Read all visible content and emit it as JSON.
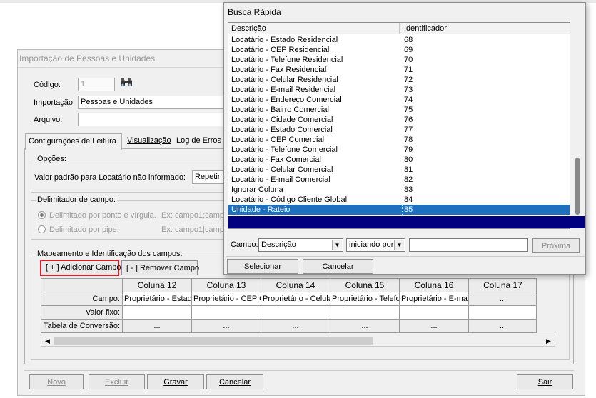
{
  "main_window": {
    "title": "Importação de Pessoas e Unidades",
    "codigo_label": "Código:",
    "codigo_value": "1",
    "importacao_label": "Importação:",
    "importacao_value": "Pessoas e Unidades",
    "arquivo_label": "Arquivo:",
    "arquivo_value": "",
    "tabs": [
      {
        "label": "Configurações de Leitura"
      },
      {
        "label": "Visualização"
      },
      {
        "label": "Log de Erros d"
      }
    ],
    "opcoes": {
      "title": "Opções:",
      "default_locatario_label": "Valor padrão para Locatário não informado:",
      "default_locatario_value": "Repetir P"
    },
    "delimitador": {
      "title": "Delimitador de campo:",
      "option1_label": "Delimitado por ponto e vírgula.",
      "option1_example": "Ex: campo1;camp",
      "option2_label": "Delimitado por pipe.",
      "option2_example": "Ex: campo1|camp"
    },
    "mapeamento": {
      "title": "Mapeamento e Identificação dos campos:",
      "add_button": "[ + ] Adicionar Campo",
      "remove_button": "[ - ] Remover Campo"
    },
    "grid": {
      "columns": [
        "Coluna 12",
        "Coluna 13",
        "Coluna 14",
        "Coluna 15",
        "Coluna 16",
        "Coluna 17"
      ],
      "row_labels": [
        "Campo:",
        "Valor fixo:",
        "Tabela de Conversão:"
      ],
      "campo_values": [
        "Proprietário - Estado",
        "Proprietário - CEP C",
        "Proprietário - Celular",
        "Proprietário - Telefo",
        "Proprietário - E-mail",
        "..."
      ],
      "dots": "..."
    },
    "buttons": {
      "novo": "Novo",
      "excluir": "Excluir",
      "gravar": "Gravar",
      "cancelar": "Cancelar",
      "sair": "Sair"
    }
  },
  "busca_rapida": {
    "title": "Busca Rápida",
    "columns": [
      "Descrição",
      "Identificador"
    ],
    "rows": [
      {
        "desc": "Locatário - Estado Residencial",
        "id": "68"
      },
      {
        "desc": "Locatário - CEP Residencial",
        "id": "69"
      },
      {
        "desc": "Locatário - Telefone Residencial",
        "id": "70"
      },
      {
        "desc": "Locatário - Fax Residencial",
        "id": "71"
      },
      {
        "desc": "Locatário - Celular Residencial",
        "id": "72"
      },
      {
        "desc": "Locatário - E-mail Residencial",
        "id": "73"
      },
      {
        "desc": "Locatário  - Endereço Comercial",
        "id": "74"
      },
      {
        "desc": "Locatário - Bairro Comercial",
        "id": "75"
      },
      {
        "desc": "Locatário - Cidade Comercial",
        "id": "76"
      },
      {
        "desc": "Locatário - Estado Comercial",
        "id": "77"
      },
      {
        "desc": "Locatário - CEP Comercial",
        "id": "78"
      },
      {
        "desc": "Locatário  - Telefone Comercial",
        "id": "79"
      },
      {
        "desc": "Locatário  - Fax Comercial",
        "id": "80"
      },
      {
        "desc": "Locatário - Celular Comercial",
        "id": "81"
      },
      {
        "desc": "Locatário - E-mail Comercial",
        "id": "82"
      },
      {
        "desc": "Ignorar Coluna",
        "id": "83"
      },
      {
        "desc": "Locatário - Código Cliente Global",
        "id": "84"
      },
      {
        "desc": "Unidade - Rateio",
        "id": "85"
      }
    ],
    "selected_index": 17,
    "campo_label": "Campo:",
    "campo_value": "Descrição",
    "match_value": "iniciando por",
    "search_value": "",
    "proxima_button": "Próxima",
    "selecionar_button": "Selecionar",
    "cancelar_button": "Cancelar"
  },
  "colors": {
    "selection": "#1f6fbf",
    "highlight_outline": "#d8202a",
    "navy_bar": "#000080"
  }
}
